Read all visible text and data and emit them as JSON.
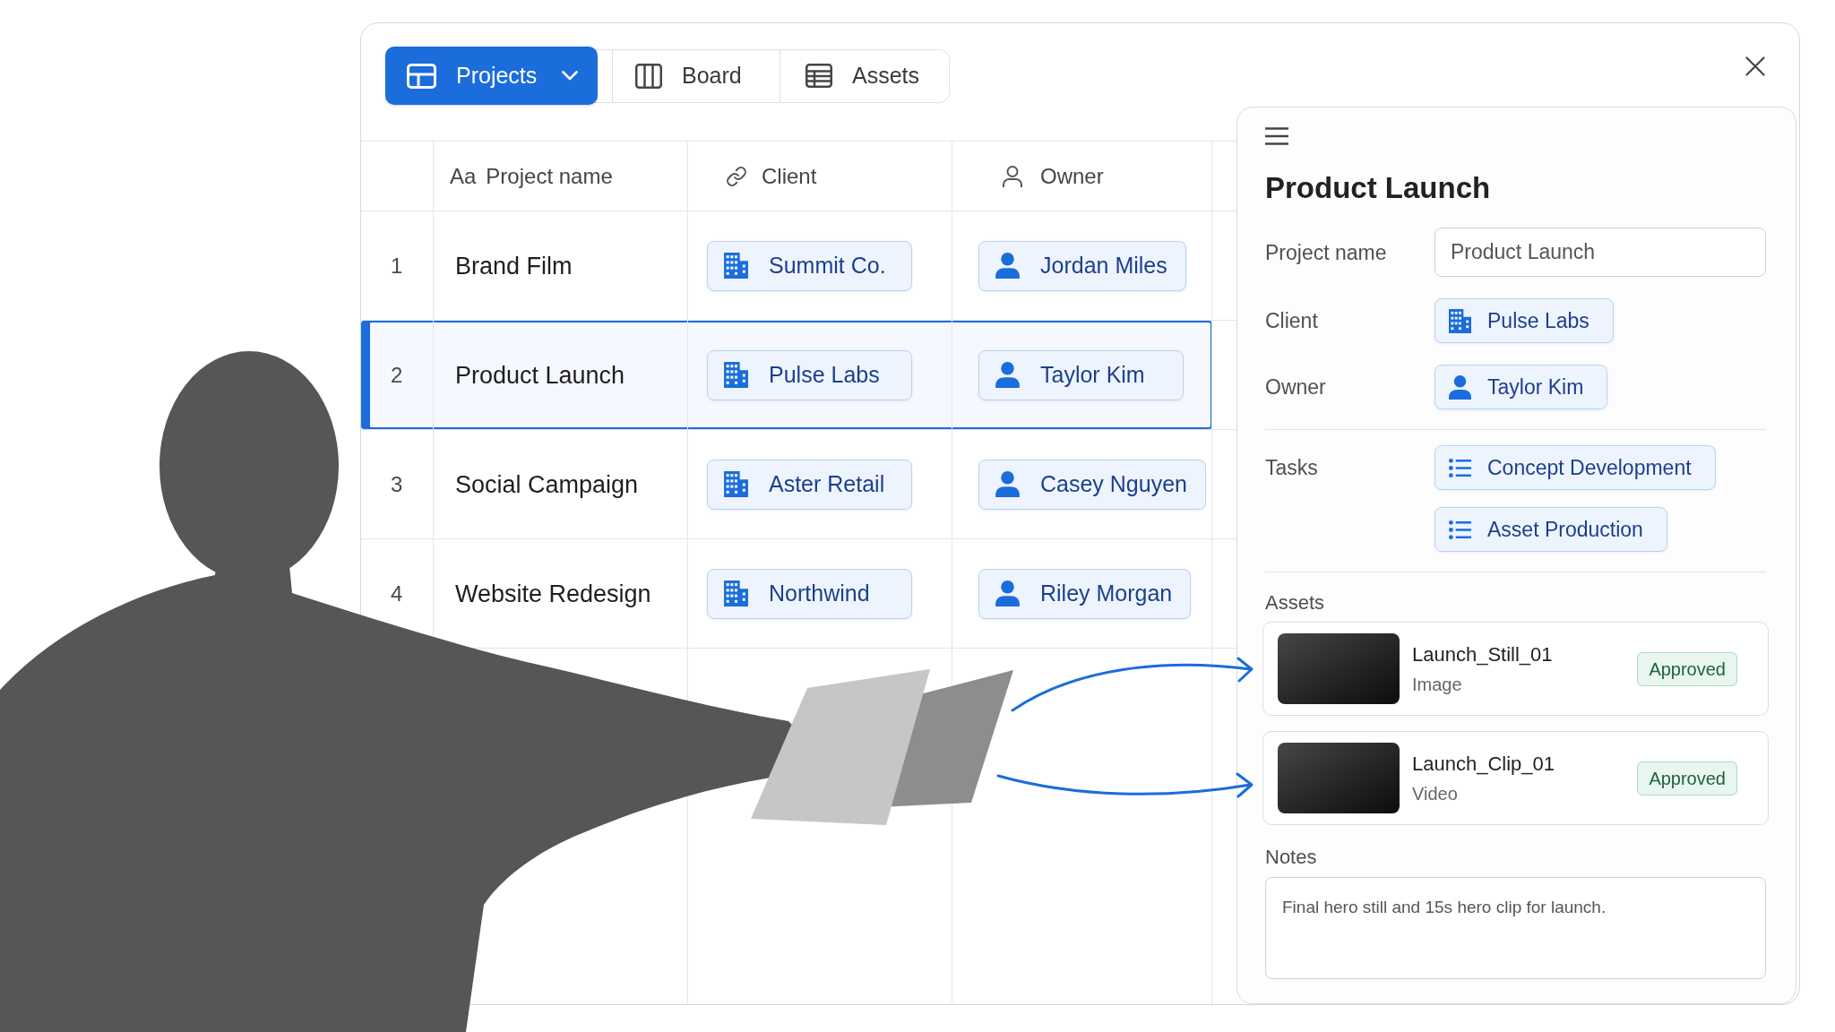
{
  "view_tabs": [
    {
      "label": "Projects",
      "selected": true,
      "menu": true
    },
    {
      "label": "Board",
      "selected": false,
      "menu": false
    },
    {
      "label": "Assets",
      "selected": false,
      "menu": false
    }
  ],
  "table": {
    "columns": [
      {
        "label": "Project name",
        "kind": "text",
        "prefix": "Aa"
      },
      {
        "label": "Client",
        "kind": "link"
      },
      {
        "label": "Owner",
        "kind": "person"
      }
    ],
    "rows": [
      {
        "number": "1",
        "cells": [
          "Brand Film",
          "Summit Co.",
          "Jordan Miles"
        ],
        "selected": false
      },
      {
        "number": "2",
        "cells": [
          "Product Launch",
          "Pulse Labs",
          "Taylor Kim"
        ],
        "selected": true
      },
      {
        "number": "3",
        "cells": [
          "Social Campaign",
          "Aster Retail",
          "Casey Nguyen"
        ],
        "selected": false
      },
      {
        "number": "4",
        "cells": [
          "Website Redesign",
          "Northwind",
          "Riley Morgan"
        ],
        "selected": false
      }
    ]
  },
  "detail_panel": {
    "title": "Product Launch",
    "sections": [
      {
        "fields": [
          {
            "label": "Project name",
            "kind": "input",
            "values": [
              "Product Launch"
            ]
          },
          {
            "label": "Client",
            "kind": "link",
            "values": [
              "Pulse Labs"
            ]
          },
          {
            "label": "Owner",
            "kind": "person",
            "values": [
              "Taylor Kim"
            ]
          }
        ]
      },
      {
        "fields": [
          {
            "label": "Tasks",
            "kind": "task",
            "values": [
              "Concept Development",
              "Asset Production"
            ]
          }
        ]
      }
    ],
    "assets": {
      "label": "Assets",
      "items": [
        {
          "name": "Launch_Still_01",
          "type": "Image",
          "status": "Approved"
        },
        {
          "name": "Launch_Clip_01",
          "type": "Video",
          "status": "Approved"
        }
      ]
    },
    "notes": {
      "label": "Notes",
      "value": "Final hero still and 15s hero clip for launch."
    }
  }
}
